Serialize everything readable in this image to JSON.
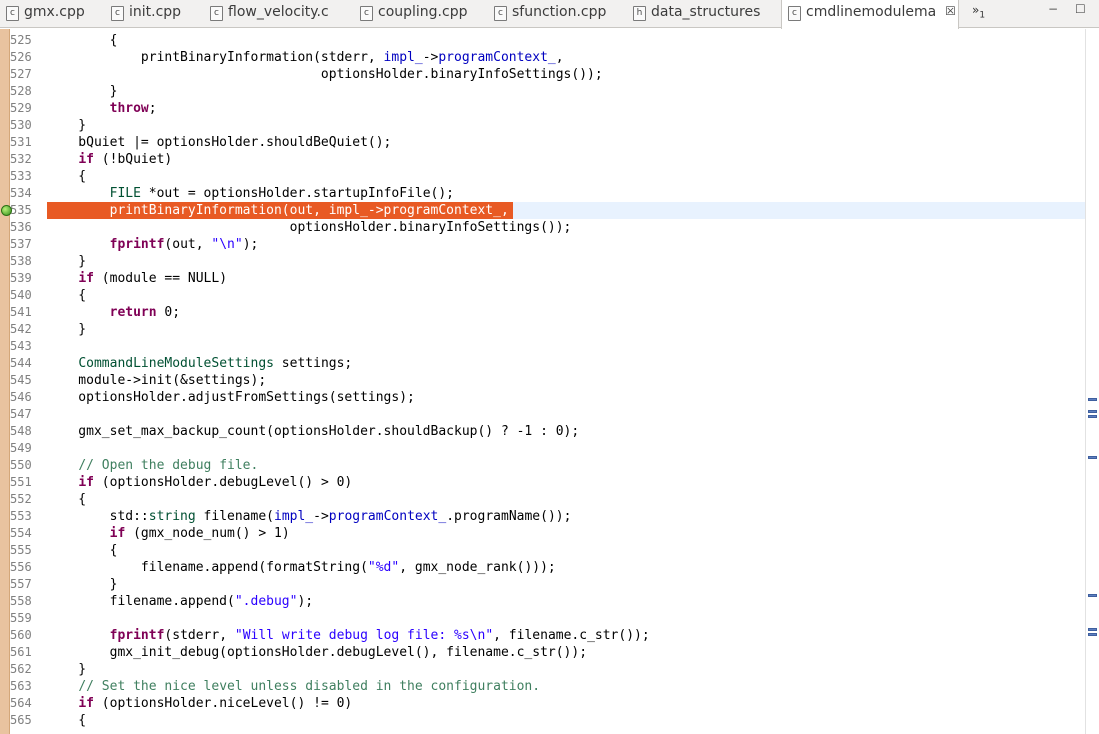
{
  "tabs": [
    {
      "label": "gmx.cpp",
      "icon": "c"
    },
    {
      "label": "init.cpp",
      "icon": "c"
    },
    {
      "label": "flow_velocity.c",
      "icon": "c"
    },
    {
      "label": "coupling.cpp",
      "icon": "c"
    },
    {
      "label": "sfunction.cpp",
      "icon": "c"
    },
    {
      "label": "data_structures",
      "icon": "h"
    },
    {
      "label": "cmdlinemodulema",
      "icon": "c",
      "active": true
    }
  ],
  "overflow": {
    "chevrons": "»",
    "count": "1"
  },
  "window_controls": {
    "minimize": "−",
    "maximize": "☐"
  },
  "editor": {
    "highlight_color": "#e85a24",
    "current_line_color": "#e8f2fe",
    "current_line": 535,
    "breakpoint_line": 535,
    "lines": [
      {
        "no": "525",
        "tokens": [
          {
            "t": "        {",
            "c": ""
          }
        ]
      },
      {
        "no": "526",
        "tokens": [
          {
            "t": "            printBinaryInformation(stderr, ",
            "c": ""
          },
          {
            "t": "impl_",
            "c": "fld"
          },
          {
            "t": "->",
            "c": ""
          },
          {
            "t": "programContext_",
            "c": "fld"
          },
          {
            "t": ",",
            "c": ""
          }
        ]
      },
      {
        "no": "527",
        "tokens": [
          {
            "t": "                                   optionsHolder.binaryInfoSettings());",
            "c": ""
          }
        ]
      },
      {
        "no": "528",
        "tokens": [
          {
            "t": "        }",
            "c": ""
          }
        ]
      },
      {
        "no": "529",
        "tokens": [
          {
            "t": "        ",
            "c": ""
          },
          {
            "t": "throw",
            "c": "kw"
          },
          {
            "t": ";",
            "c": ""
          }
        ]
      },
      {
        "no": "530",
        "tokens": [
          {
            "t": "    }",
            "c": ""
          }
        ]
      },
      {
        "no": "531",
        "tokens": [
          {
            "t": "    bQuiet |= optionsHolder.shouldBeQuiet();",
            "c": ""
          }
        ]
      },
      {
        "no": "532",
        "tokens": [
          {
            "t": "    ",
            "c": ""
          },
          {
            "t": "if",
            "c": "kw"
          },
          {
            "t": " (!bQuiet)",
            "c": ""
          }
        ]
      },
      {
        "no": "533",
        "tokens": [
          {
            "t": "    {",
            "c": ""
          }
        ]
      },
      {
        "no": "534",
        "tokens": [
          {
            "t": "        ",
            "c": ""
          },
          {
            "t": "FILE",
            "c": "ty"
          },
          {
            "t": " *out = optionsHolder.startupInfoFile();",
            "c": ""
          }
        ]
      },
      {
        "no": "535",
        "highlight": true,
        "tokens": [
          {
            "t": "        printBinaryInformation(out, impl_->programContext_,",
            "c": "hl"
          }
        ]
      },
      {
        "no": "536",
        "tokens": [
          {
            "t": "                               optionsHolder.binaryInfoSettings());",
            "c": ""
          }
        ]
      },
      {
        "no": "537",
        "tokens": [
          {
            "t": "        ",
            "c": ""
          },
          {
            "t": "fprintf",
            "c": "kw"
          },
          {
            "t": "(out, ",
            "c": ""
          },
          {
            "t": "\"\\n\"",
            "c": "str"
          },
          {
            "t": ");",
            "c": ""
          }
        ]
      },
      {
        "no": "538",
        "tokens": [
          {
            "t": "    }",
            "c": ""
          }
        ]
      },
      {
        "no": "539",
        "tokens": [
          {
            "t": "    ",
            "c": ""
          },
          {
            "t": "if",
            "c": "kw"
          },
          {
            "t": " (module == NULL)",
            "c": ""
          }
        ]
      },
      {
        "no": "540",
        "tokens": [
          {
            "t": "    {",
            "c": ""
          }
        ]
      },
      {
        "no": "541",
        "tokens": [
          {
            "t": "        ",
            "c": ""
          },
          {
            "t": "return",
            "c": "kw"
          },
          {
            "t": " 0;",
            "c": ""
          }
        ]
      },
      {
        "no": "542",
        "tokens": [
          {
            "t": "    }",
            "c": ""
          }
        ]
      },
      {
        "no": "543",
        "tokens": [
          {
            "t": "",
            "c": ""
          }
        ]
      },
      {
        "no": "544",
        "tokens": [
          {
            "t": "    ",
            "c": ""
          },
          {
            "t": "CommandLineModuleSettings",
            "c": "ty"
          },
          {
            "t": " settings;",
            "c": ""
          }
        ]
      },
      {
        "no": "545",
        "tokens": [
          {
            "t": "    module->init(&settings);",
            "c": ""
          }
        ]
      },
      {
        "no": "546",
        "tokens": [
          {
            "t": "    optionsHolder.adjustFromSettings(settings);",
            "c": ""
          }
        ]
      },
      {
        "no": "547",
        "tokens": [
          {
            "t": "",
            "c": ""
          }
        ]
      },
      {
        "no": "548",
        "tokens": [
          {
            "t": "    gmx_set_max_backup_count(optionsHolder.shouldBackup() ? -1 : 0);",
            "c": ""
          }
        ]
      },
      {
        "no": "549",
        "tokens": [
          {
            "t": "",
            "c": ""
          }
        ]
      },
      {
        "no": "550",
        "tokens": [
          {
            "t": "    ",
            "c": ""
          },
          {
            "t": "// Open the debug file.",
            "c": "cm"
          }
        ]
      },
      {
        "no": "551",
        "tokens": [
          {
            "t": "    ",
            "c": ""
          },
          {
            "t": "if",
            "c": "kw"
          },
          {
            "t": " (optionsHolder.debugLevel() > 0)",
            "c": ""
          }
        ]
      },
      {
        "no": "552",
        "tokens": [
          {
            "t": "    {",
            "c": ""
          }
        ]
      },
      {
        "no": "553",
        "tokens": [
          {
            "t": "        std::",
            "c": ""
          },
          {
            "t": "string",
            "c": "ty"
          },
          {
            "t": " filename(",
            "c": ""
          },
          {
            "t": "impl_",
            "c": "fld"
          },
          {
            "t": "->",
            "c": ""
          },
          {
            "t": "programContext_",
            "c": "fld"
          },
          {
            "t": ".programName());",
            "c": ""
          }
        ]
      },
      {
        "no": "554",
        "tokens": [
          {
            "t": "        ",
            "c": ""
          },
          {
            "t": "if",
            "c": "kw"
          },
          {
            "t": " (gmx_node_num() > 1)",
            "c": ""
          }
        ]
      },
      {
        "no": "555",
        "tokens": [
          {
            "t": "        {",
            "c": ""
          }
        ]
      },
      {
        "no": "556",
        "tokens": [
          {
            "t": "            filename.append(formatString(",
            "c": ""
          },
          {
            "t": "\"%d\"",
            "c": "str"
          },
          {
            "t": ", gmx_node_rank()));",
            "c": ""
          }
        ]
      },
      {
        "no": "557",
        "tokens": [
          {
            "t": "        }",
            "c": ""
          }
        ]
      },
      {
        "no": "558",
        "tokens": [
          {
            "t": "        filename.append(",
            "c": ""
          },
          {
            "t": "\".debug\"",
            "c": "str"
          },
          {
            "t": ");",
            "c": ""
          }
        ]
      },
      {
        "no": "559",
        "tokens": [
          {
            "t": "",
            "c": ""
          }
        ]
      },
      {
        "no": "560",
        "tokens": [
          {
            "t": "        ",
            "c": ""
          },
          {
            "t": "fprintf",
            "c": "kw"
          },
          {
            "t": "(stderr, ",
            "c": ""
          },
          {
            "t": "\"Will write debug log file: %s\\n\"",
            "c": "str"
          },
          {
            "t": ", filename.c_str());",
            "c": ""
          }
        ]
      },
      {
        "no": "561",
        "tokens": [
          {
            "t": "        gmx_init_debug(optionsHolder.debugLevel(), filename.c_str());",
            "c": ""
          }
        ]
      },
      {
        "no": "562",
        "tokens": [
          {
            "t": "    }",
            "c": ""
          }
        ]
      },
      {
        "no": "563",
        "tokens": [
          {
            "t": "    ",
            "c": ""
          },
          {
            "t": "// Set the nice level unless disabled in the configuration.",
            "c": "cm"
          }
        ]
      },
      {
        "no": "564",
        "tokens": [
          {
            "t": "    ",
            "c": ""
          },
          {
            "t": "if",
            "c": "kw"
          },
          {
            "t": " (optionsHolder.niceLevel() != 0)",
            "c": ""
          }
        ]
      },
      {
        "no": "565",
        "tokens": [
          {
            "t": "    {",
            "c": ""
          }
        ]
      }
    ]
  }
}
